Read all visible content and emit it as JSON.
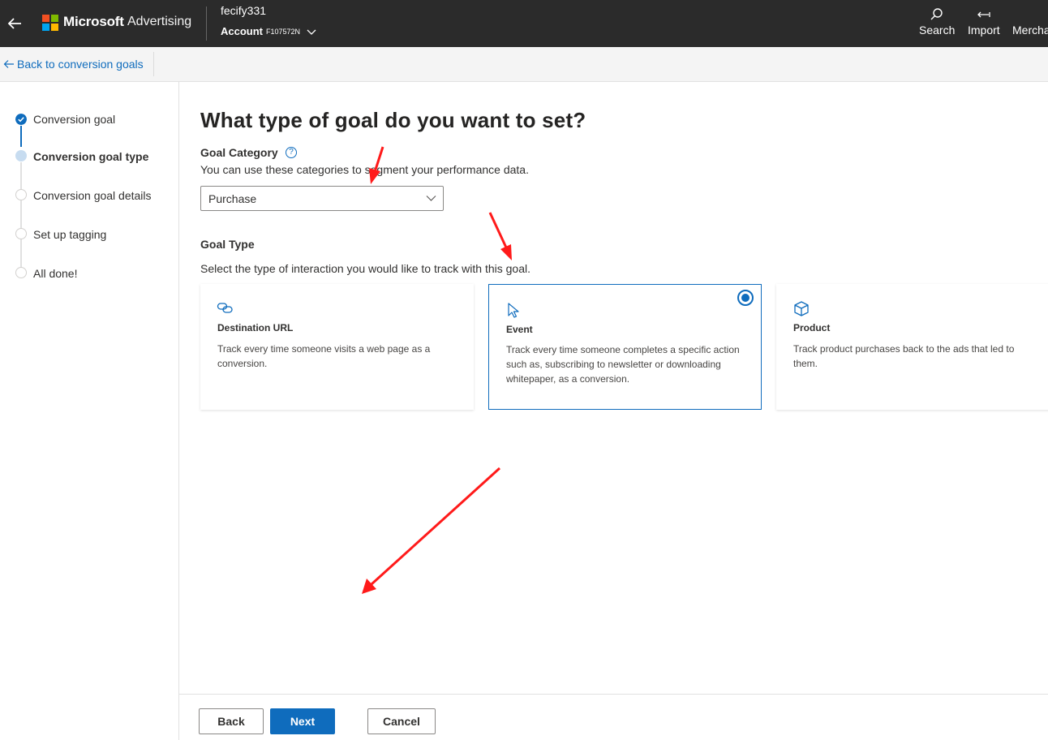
{
  "header": {
    "brand": "Microsoft",
    "product": "Advertising",
    "account_user": "fecify331",
    "account_label": "Account",
    "account_id": "F107572N",
    "actions": [
      {
        "label": "Search",
        "icon": "search-icon"
      },
      {
        "label": "Import",
        "icon": "import-icon"
      },
      {
        "label": "Mercha",
        "icon": "merchant-icon"
      }
    ],
    "logo_colors": [
      "#f25022",
      "#7fba00",
      "#00a4ef",
      "#ffb900"
    ]
  },
  "subheader": {
    "back_link": "Back to conversion goals"
  },
  "steps": [
    {
      "label": "Conversion goal",
      "state": "complete"
    },
    {
      "label": "Conversion goal type",
      "state": "current"
    },
    {
      "label": "Conversion goal details",
      "state": "pending"
    },
    {
      "label": "Set up tagging",
      "state": "pending"
    },
    {
      "label": "All done!",
      "state": "pending"
    }
  ],
  "main": {
    "title": "What type of goal do you want to set?",
    "goal_category": {
      "label": "Goal Category",
      "help": "?",
      "description": "You can use these categories to segment your performance data.",
      "selected": "Purchase"
    },
    "goal_type": {
      "label": "Goal Type",
      "description": "Select the type of interaction you would like to track with this goal.",
      "options": [
        {
          "title": "Destination URL",
          "description": "Track every time someone visits a web page as a conversion.",
          "icon": "link-icon",
          "selected": false
        },
        {
          "title": "Event",
          "description": "Track every time someone completes a specific action such as, subscribing to newsletter or downloading whitepaper, as a conversion.",
          "icon": "cursor-icon",
          "selected": true
        },
        {
          "title": "Product",
          "description": "Track product purchases back to the ads that led to them.",
          "icon": "box-icon",
          "selected": false
        }
      ]
    }
  },
  "footer": {
    "back": "Back",
    "next": "Next",
    "cancel": "Cancel"
  },
  "colors": {
    "accent": "#0f6cbd",
    "topbar": "#2b2b2b",
    "annotation": "#ff1a1a"
  }
}
